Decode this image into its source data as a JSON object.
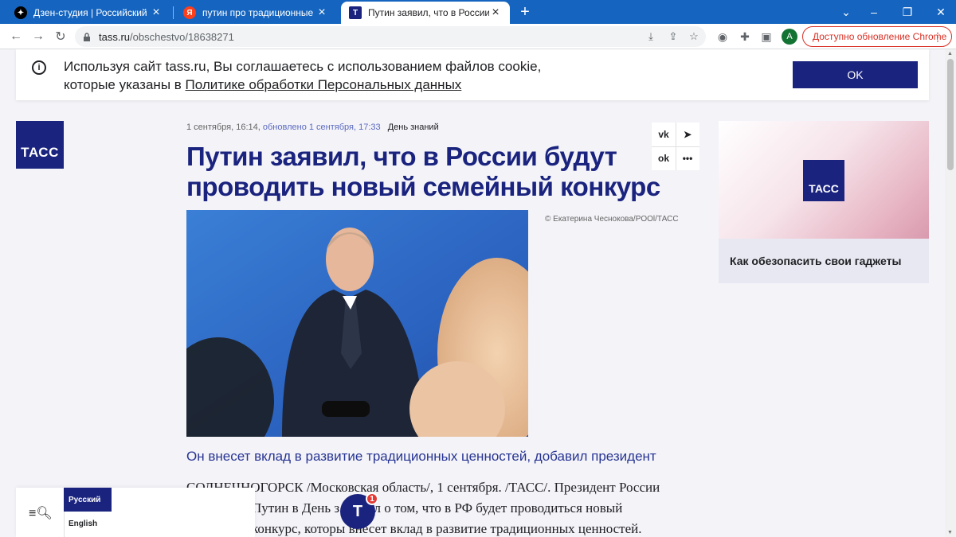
{
  "browser": {
    "tabs": [
      {
        "title": "Дзен-студия | Российский флаг",
        "favicon": "dzen-icon",
        "active": false
      },
      {
        "title": "путин про традиционные ценн",
        "favicon": "yandex-icon",
        "active": false
      },
      {
        "title": "Путин заявил, что в России буд",
        "favicon": "tass-icon",
        "active": true
      }
    ],
    "new_tab_label": "+",
    "window_controls": {
      "minimize": "–",
      "restore": "❐",
      "close": "✕",
      "collapse": "⌄"
    },
    "url_host": "tass.ru",
    "url_path": "/obschestvo/18638271",
    "profile_initial": "A",
    "update_label": "Доступно обновление Chrome",
    "accent_color": "#1565c0"
  },
  "cookie_banner": {
    "text": "Используя сайт tass.ru, Вы соглашаетесь с использованием файлов cookie, которые указаны в ",
    "link": "Политике обработки Персональных данных",
    "ok_label": "OK"
  },
  "logo": {
    "label": "ТАСС"
  },
  "article": {
    "date": "1 сентября, 16:14,",
    "updated": "обновлено 1 сентября, 17:33",
    "tag": "День знаний",
    "headline": "Путин заявил, что в России будут проводить новый семейный конкурс",
    "photo_credit": "© Екатерина Чеснокова/POOl/ТАСС",
    "lead": "Он внесет вклад в развитие традиционных ценностей, добавил президент",
    "body_line1": "СОЛНЕЧНОГОРСК /Московская область/, 1 сентября. /ТАСС/. Президент России",
    "body_line2": "Путин в День з       заявил о том, что в РФ будет проводиться новый",
    "body_line3": "конкурс, которы    внесет вклад в развитие традиционных ценностей."
  },
  "share": {
    "vk": "vk",
    "telegram": "➤",
    "ok": "ok",
    "more": "•••"
  },
  "ad": {
    "logo_label": "ТАСС",
    "caption": "Как обезопасить свои гаджеты"
  },
  "language_bar": {
    "russian": "Русский",
    "english": "English"
  },
  "notification": {
    "letter": "T",
    "count": "1"
  },
  "brand_color": "#1a237e"
}
